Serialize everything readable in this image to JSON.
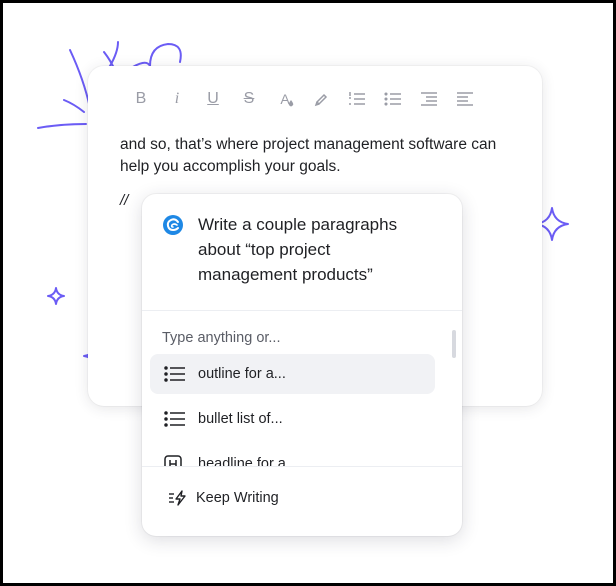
{
  "editor": {
    "toolbar": [
      {
        "name": "bold-button",
        "label": "B",
        "icon": "bold-icon"
      },
      {
        "name": "italic-button",
        "label": "i",
        "icon": "italic-icon"
      },
      {
        "name": "underline-button",
        "label": "U",
        "icon": "underline-icon"
      },
      {
        "name": "strikethrough-button",
        "label": "S",
        "icon": "strikethrough-icon"
      },
      {
        "name": "text-color-button",
        "label": "A",
        "icon": "text-color-icon"
      },
      {
        "name": "highlight-button",
        "label": "",
        "icon": "highlighter-icon"
      },
      {
        "name": "numbered-list-button",
        "label": "",
        "icon": "numbered-list-icon"
      },
      {
        "name": "bullet-list-button",
        "label": "",
        "icon": "bullet-list-icon"
      },
      {
        "name": "outdent-button",
        "label": "",
        "icon": "outdent-icon"
      },
      {
        "name": "indent-button",
        "label": "",
        "icon": "indent-icon"
      }
    ],
    "body_text": "and so, that’s where project management software can help you accomplish your goals.",
    "command_trigger": "//"
  },
  "ai_popup": {
    "logo_icon": "ai-assistant-logo-icon",
    "prompt": "Write a couple paragraphs\nabout “top project\nmanagement products”",
    "hint": "Type anything or...",
    "suggestions": [
      {
        "label": "outline for a...",
        "icon": "list-icon",
        "active": true
      },
      {
        "label": "bullet list of...",
        "icon": "list-icon",
        "active": false
      },
      {
        "label": "headline for a...",
        "icon": "heading-icon",
        "active": false
      }
    ],
    "keep_writing_label": "Keep Writing",
    "keep_writing_icon": "continue-writing-icon"
  },
  "colors": {
    "accent": "#6B5CF5",
    "logo": "#1E88E5",
    "text": "#1F2024",
    "muted": "#9A9CA6"
  }
}
